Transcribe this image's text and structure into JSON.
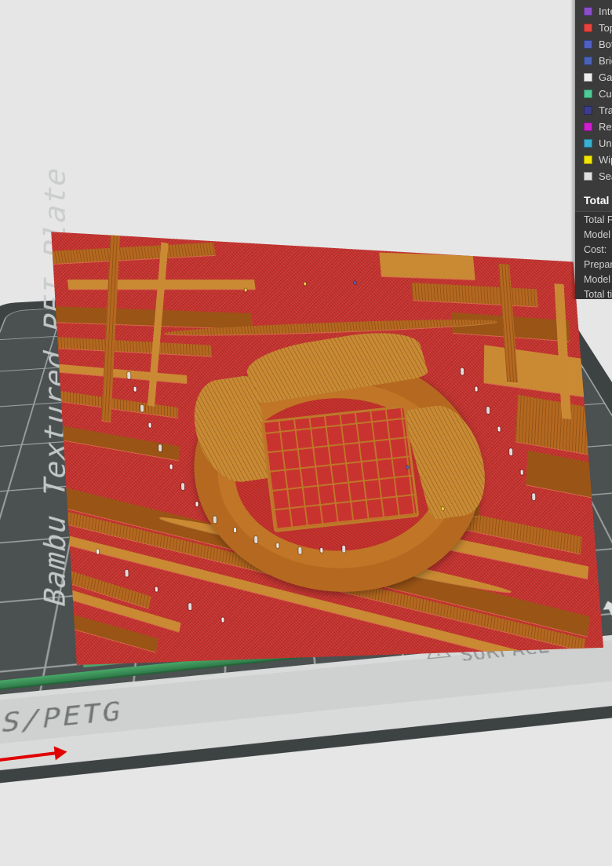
{
  "app": {
    "view": "Preview",
    "background_color": "#e6e6e6"
  },
  "plate": {
    "name": "Bambu Textured PEI Plate",
    "front_material_label": "PLA/ABS/PETG",
    "hot_surface_label": "HOT\nSURFACE",
    "surface_color": "#4b5050",
    "grid_line_color": "#a9adad",
    "frame_color": "#3d4242"
  },
  "axis": {
    "x_axis_color": "#e00000",
    "x_axis_label": ""
  },
  "model": {
    "description": "sliced stadium terrain model",
    "infill_color": "#c9332f",
    "perimeter_color": "#b5681f",
    "highlight_color": "#c98a33",
    "support_color": "#dcdcdc"
  },
  "purge_line": {
    "color": "#2f7a49"
  },
  "legend": {
    "items": [
      {
        "label": "Internal infill",
        "color": "#8b4ecb",
        "pattern": "solid"
      },
      {
        "label": "Top surface",
        "color": "#e8433c",
        "pattern": "solid"
      },
      {
        "label": "Bottom surface",
        "color": "#5061c4",
        "pattern": "solid"
      },
      {
        "label": "Bridge infill",
        "color": "#4a63b8",
        "pattern": "dotted"
      },
      {
        "label": "Gap infill",
        "color": "#eeeeee",
        "pattern": "solid"
      },
      {
        "label": "Custom",
        "color": "#4ecb97",
        "pattern": "solid"
      },
      {
        "label": "Travel",
        "color": "#3c3c8c",
        "pattern": "solid"
      },
      {
        "label": "Retractions",
        "color": "#cf1fd0",
        "pattern": "solid"
      },
      {
        "label": "Unretractions",
        "color": "#38b0d2",
        "pattern": "solid"
      },
      {
        "label": "Wipe",
        "color": "#f2e500",
        "pattern": "solid"
      },
      {
        "label": "Seams",
        "color": "#dfdfdf",
        "pattern": "solid"
      }
    ],
    "total_header": "Total",
    "stats": [
      {
        "label": "Total Filament:"
      },
      {
        "label": "Model Filament:"
      },
      {
        "label": "Cost:"
      },
      {
        "label": "Prepare time:"
      },
      {
        "label": "Model printing time:"
      },
      {
        "label": "Total time:"
      }
    ]
  }
}
